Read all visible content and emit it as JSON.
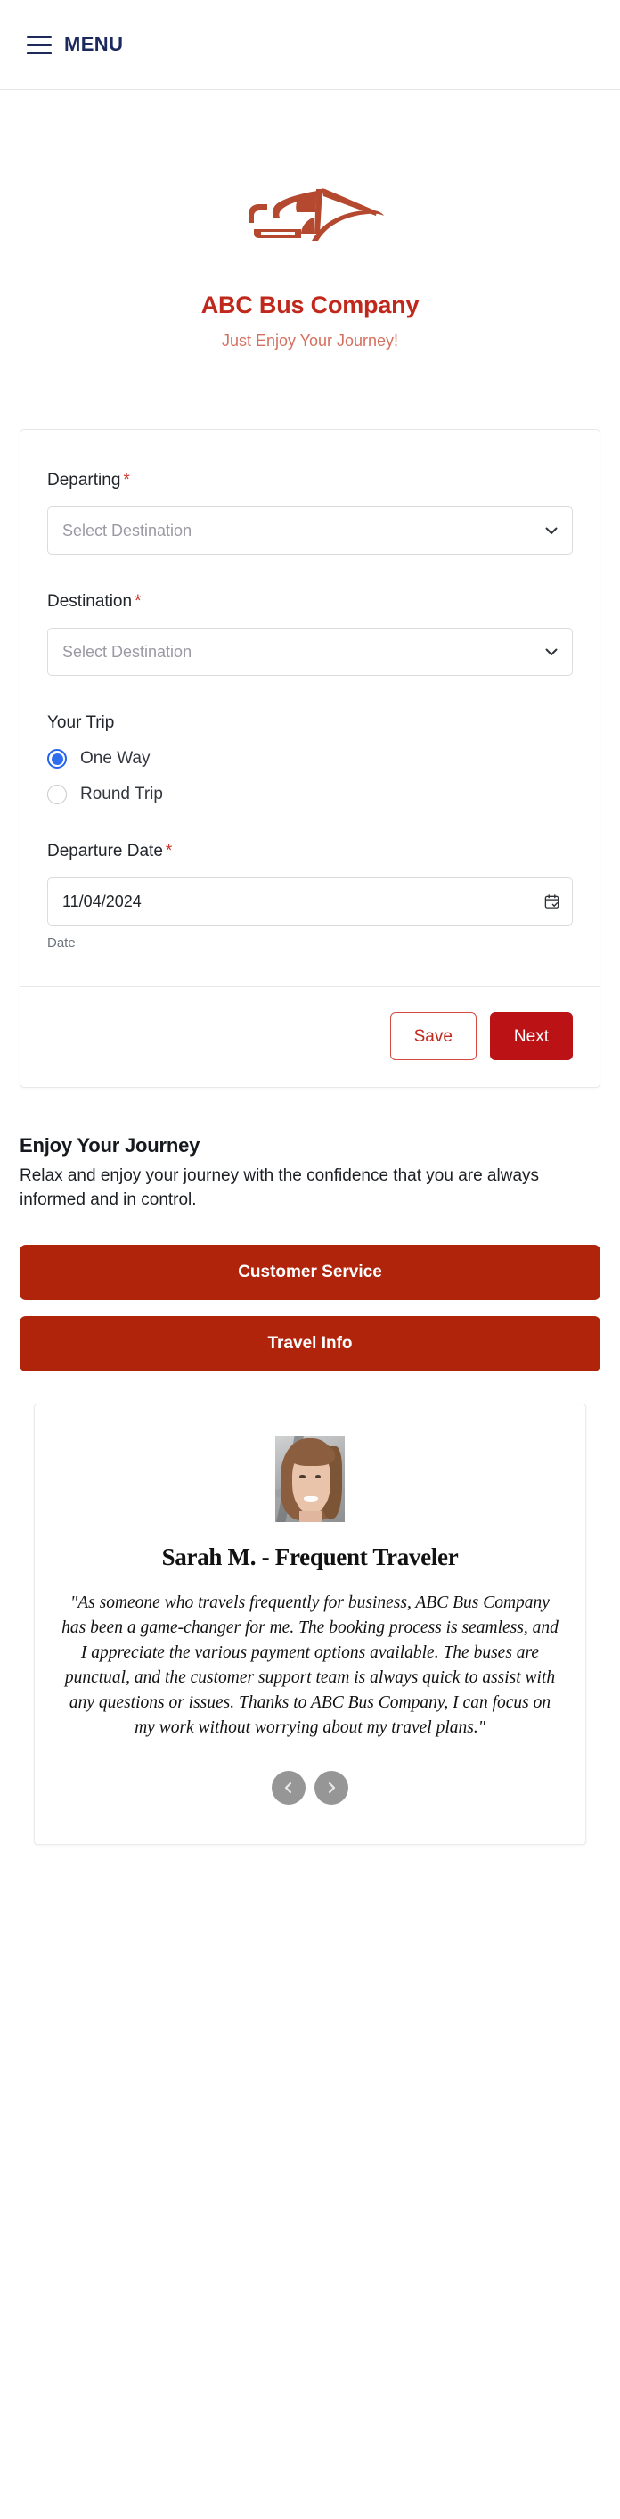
{
  "header": {
    "menu_label": "MENU",
    "menu_icon": "hamburger-icon",
    "accent_color": "#1b2a5b"
  },
  "brand": {
    "logo_icon": "bus-logo-icon",
    "name": "ABC Bus Company",
    "tagline": "Just Enjoy Your Journey!",
    "name_color": "#c0281c",
    "tagline_color": "#d4705f"
  },
  "form": {
    "departing": {
      "label": "Departing",
      "required_marker": "*",
      "placeholder": "Select Destination",
      "value": "",
      "chevron_icon": "chevron-down-icon"
    },
    "destination": {
      "label": "Destination",
      "required_marker": "*",
      "placeholder": "Select Destination",
      "value": "",
      "chevron_icon": "chevron-down-icon"
    },
    "trip": {
      "label": "Your Trip",
      "options": [
        {
          "label": "One Way",
          "selected": true
        },
        {
          "label": "Round Trip",
          "selected": false
        }
      ],
      "selected_color": "#2f6fed"
    },
    "departure_date": {
      "label": "Departure Date",
      "required_marker": "*",
      "value": "11/04/2024",
      "helper": "Date",
      "calendar_icon": "calendar-check-icon"
    },
    "buttons": {
      "save_label": "Save",
      "next_label": "Next",
      "save_color": "#c0281c",
      "next_color": "#bb1315"
    }
  },
  "promo": {
    "title": "Enjoy Your Journey",
    "text": "Relax and enjoy your journey with the confidence that you are always informed and in control."
  },
  "cta": {
    "color": "#b1240c",
    "items": [
      {
        "label": "Customer Service"
      },
      {
        "label": "Travel Info"
      }
    ]
  },
  "testimonial": {
    "avatar_alt": "customer-portrait",
    "name": "Sarah M. - Frequent Traveler",
    "quote": "\"As someone who travels frequently for business, ABC Bus Company has been a game-changer for me. The booking process is seamless, and I appreciate the various payment options available. The buses are punctual, and the customer support team is always quick to assist with any questions or issues. Thanks to ABC Bus Company, I can focus on my work without worrying about my travel plans.\"",
    "prev_icon": "chevron-left-icon",
    "next_icon": "chevron-right-icon",
    "arrow_color": "#969696"
  }
}
